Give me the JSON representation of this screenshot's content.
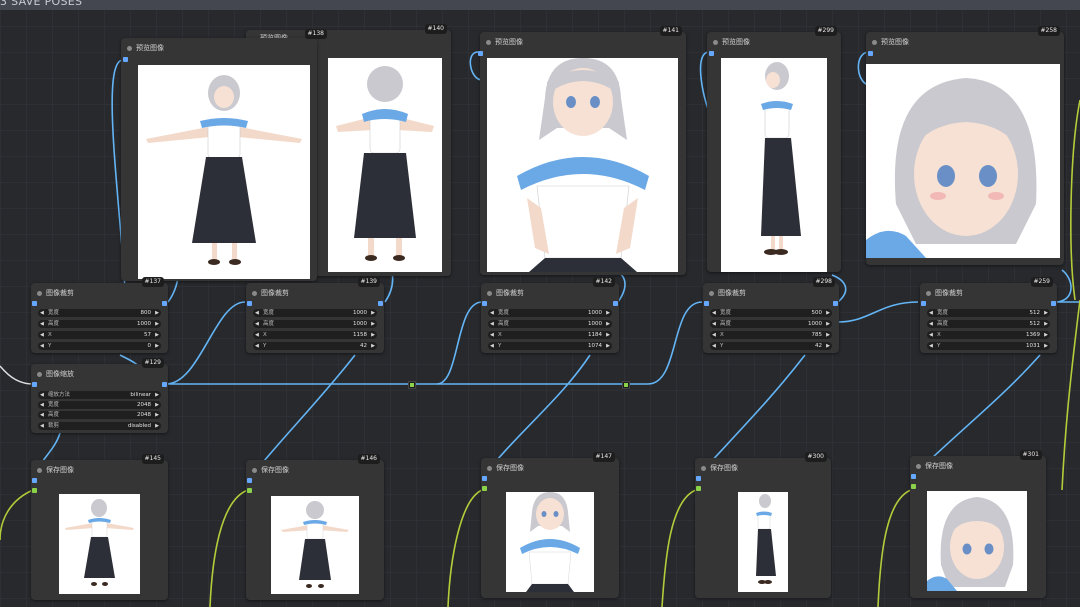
{
  "group_title": "3 SAVE POSES",
  "colors": {
    "canvas": "#27292d",
    "node": "#353535",
    "image_link": "#64b5f6",
    "mask_link": "#b5cc3a",
    "reroute": "#8bd24a"
  },
  "preview_nodes": [
    {
      "id": "#138",
      "title": "预览图像",
      "image": "tpose-front"
    },
    {
      "id": "#140",
      "title": "预览图像",
      "image": "tpose-back"
    },
    {
      "id": "#141",
      "title": "预览图像",
      "image": "hands-on-hips"
    },
    {
      "id": "#299",
      "title": "预览图像",
      "image": "side-view"
    },
    {
      "id": "#258",
      "title": "预览图像",
      "image": "face-closeup"
    }
  ],
  "back_preview": {
    "title": "预览图像"
  },
  "crop_nodes": [
    {
      "id": "#137",
      "title": "图像裁剪",
      "widgets": [
        {
          "label": "宽度",
          "value": "800"
        },
        {
          "label": "高度",
          "value": "1000"
        },
        {
          "label": "X",
          "value": "57"
        },
        {
          "label": "Y",
          "value": "0"
        }
      ]
    },
    {
      "id": "#139",
      "title": "图像裁剪",
      "widgets": [
        {
          "label": "宽度",
          "value": "1000"
        },
        {
          "label": "高度",
          "value": "1000"
        },
        {
          "label": "X",
          "value": "1158"
        },
        {
          "label": "Y",
          "value": "42"
        }
      ]
    },
    {
      "id": "#142",
      "title": "图像裁剪",
      "widgets": [
        {
          "label": "宽度",
          "value": "1000"
        },
        {
          "label": "高度",
          "value": "1000"
        },
        {
          "label": "X",
          "value": "1184"
        },
        {
          "label": "Y",
          "value": "1074"
        }
      ]
    },
    {
      "id": "#298",
      "title": "图像裁剪",
      "widgets": [
        {
          "label": "宽度",
          "value": "500"
        },
        {
          "label": "高度",
          "value": "1000"
        },
        {
          "label": "X",
          "value": "785"
        },
        {
          "label": "Y",
          "value": "42"
        }
      ]
    },
    {
      "id": "#259",
      "title": "图像裁剪",
      "widgets": [
        {
          "label": "宽度",
          "value": "512"
        },
        {
          "label": "高度",
          "value": "512"
        },
        {
          "label": "X",
          "value": "1369"
        },
        {
          "label": "Y",
          "value": "1031"
        }
      ]
    }
  ],
  "scale_node": {
    "id": "#129",
    "title": "图像缩放",
    "widgets": [
      {
        "label": "缩放方法",
        "value": "bilinear"
      },
      {
        "label": "宽度",
        "value": "2048"
      },
      {
        "label": "高度",
        "value": "2048"
      },
      {
        "label": "裁剪",
        "value": "disabled"
      }
    ]
  },
  "save_nodes": [
    {
      "id": "#145",
      "title": "保存图像",
      "image": "tpose-front"
    },
    {
      "id": "#146",
      "title": "保存图像",
      "image": "tpose-back"
    },
    {
      "id": "#147",
      "title": "保存图像",
      "image": "hands-on-hips"
    },
    {
      "id": "#300",
      "title": "保存图像",
      "image": "side-view"
    },
    {
      "id": "#301",
      "title": "保存图像",
      "image": "face-closeup"
    }
  ]
}
